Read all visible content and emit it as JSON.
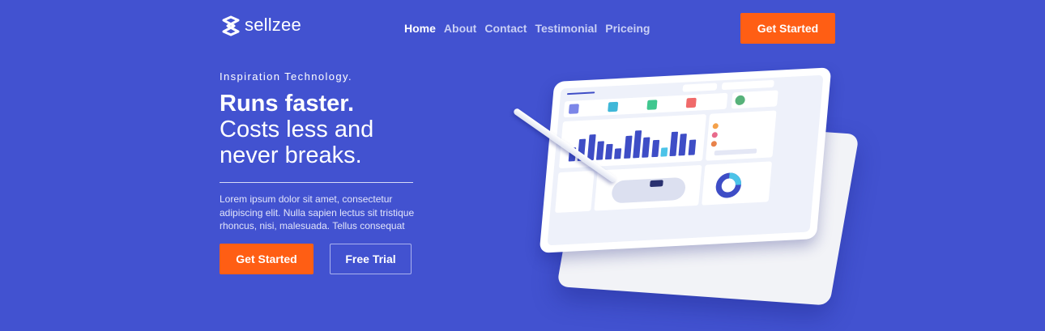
{
  "brand": {
    "name": "sellzee",
    "logo_icon": "s-logo-icon"
  },
  "nav": {
    "items": [
      {
        "label": "Home",
        "active": true
      },
      {
        "label": "About",
        "active": false
      },
      {
        "label": "Contact",
        "active": false
      },
      {
        "label": "Testimonial",
        "active": false
      },
      {
        "label": "Priceing",
        "active": false
      }
    ],
    "cta_label": "Get Started"
  },
  "hero": {
    "eyebrow": "Inspiration Technology.",
    "headline_line1": "Runs faster.",
    "headline_line2": "Costs less and",
    "headline_line3": "never breaks.",
    "description": "Lorem ipsum dolor sit amet, consectetur adipiscing elit. Nulla sapien lectus sit tristique rhoncus, nisi, malesuada. Tellus consequat",
    "primary_label": "Get Started",
    "secondary_label": "Free Trial"
  },
  "colors": {
    "background": "#4252D0",
    "accent": "#FF5E14",
    "nav_inactive": "#C9CFF5"
  },
  "illustration": {
    "subject": "tablet-dashboard-illustration",
    "bar_levels": [
      0.45,
      0.7,
      0.85,
      0.6,
      0.5,
      0.35,
      0.75,
      0.9,
      0.65,
      0.55,
      0.3,
      0.8,
      0.7,
      0.5
    ]
  }
}
